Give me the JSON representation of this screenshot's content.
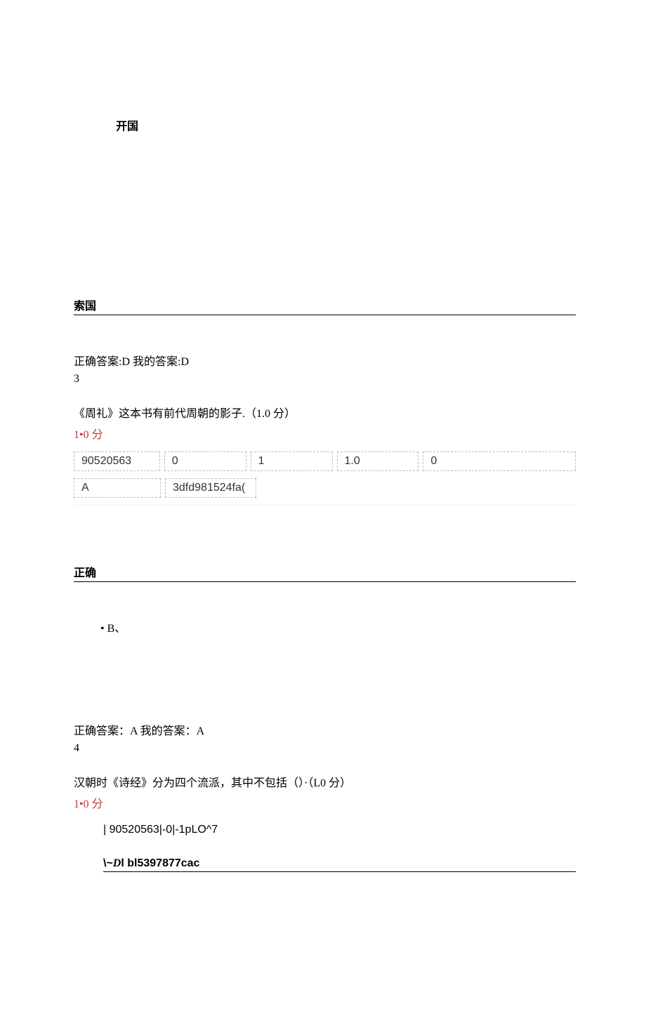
{
  "top": {
    "opt_kai": "开国",
    "opt_suo": "索国"
  },
  "q2": {
    "answer_line": "正确答案:D 我的答案:D",
    "num": "3"
  },
  "q3": {
    "stem": "《周礼》这本书有前代周朝的影子.（1.0 分）",
    "score": "1•0 分",
    "row1": {
      "c1": "90520563",
      "c2": "0",
      "c3": "1",
      "c4": "1.0",
      "c5": "0"
    },
    "row2": {
      "c1": "A",
      "c2": "3dfd981524fa("
    },
    "opt_correct": "正确",
    "opt_b": "• B、",
    "answer_line": "正确答案：A 我的答案：A",
    "num": "4"
  },
  "q4": {
    "stem": "汉朝时《诗经》分为四个流派，其中不包括（）·（L0 分）",
    "score": "1•0 分",
    "line1": "| 90520563|-0|-1pLO^7",
    "line2_pre": "\\~",
    "line2_d": "D",
    "line2_post": "l bl5397877cac"
  }
}
